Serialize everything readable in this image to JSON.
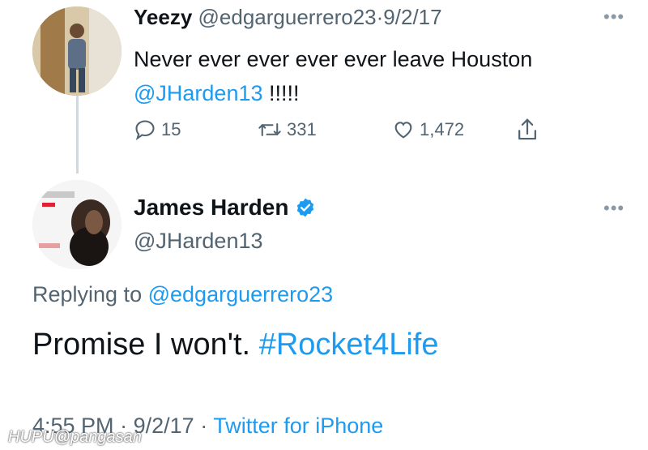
{
  "tweet": {
    "display_name": "Yeezy",
    "handle": "@edgarguerrero23",
    "separator": "·",
    "date": "9/2/17",
    "text_line1": "Never ever ever ever ever leave Houston",
    "mention": "@JHarden13",
    "text_suffix": "!!!!!",
    "replies": "15",
    "retweets": "331",
    "likes": "1,472",
    "more_icon": "more-dots-icon"
  },
  "reply": {
    "display_name": "James Harden",
    "verified_icon": "verified-badge-icon",
    "handle": "@JHarden13",
    "replying_prefix": "Replying to",
    "replying_to": "@edgarguerrero23",
    "text": "Promise I won't.",
    "hashtag": "#Rocket4Life",
    "time": "4:55 PM",
    "date": "9/2/17",
    "source": "Twitter for iPhone"
  },
  "watermark": {
    "text": "HUPU@pangasan"
  },
  "colors": {
    "link": "#1d9bf0",
    "muted": "#536471",
    "text": "#0f1419"
  }
}
